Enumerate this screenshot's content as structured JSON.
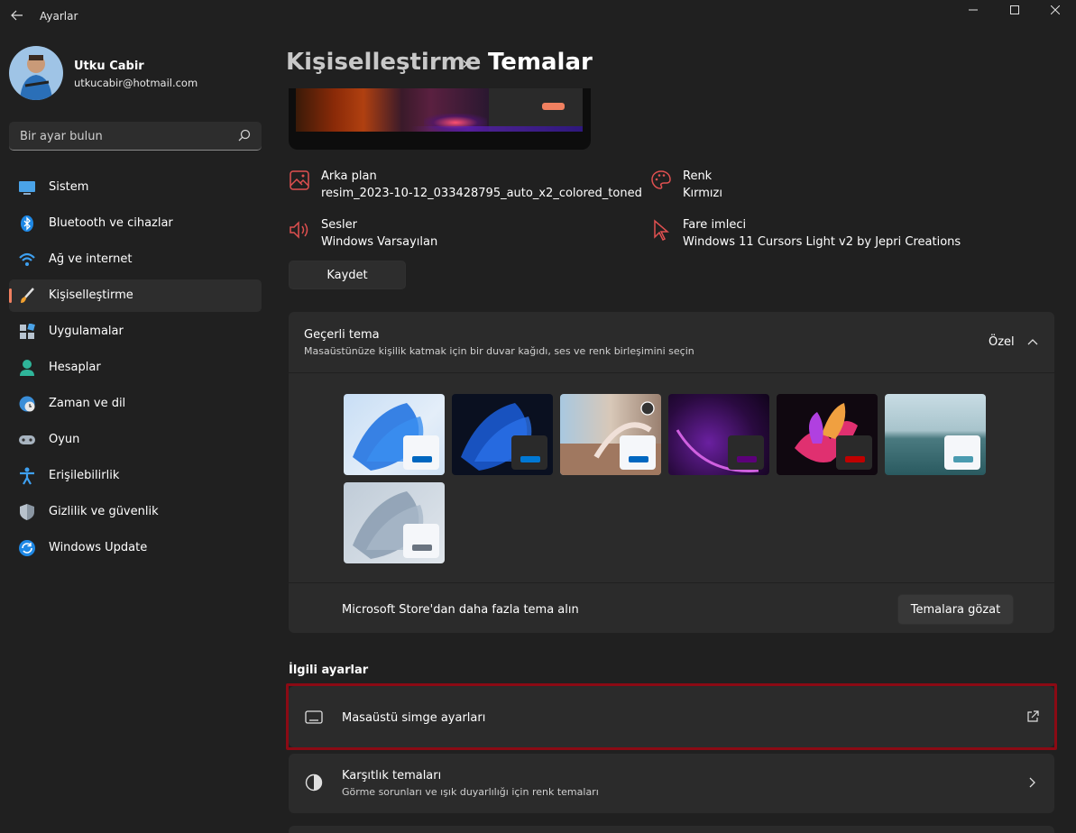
{
  "window": {
    "title": "Ayarlar"
  },
  "user": {
    "name": "Utku Cabir",
    "email": "utkucabir@hotmail.com"
  },
  "search": {
    "placeholder": "Bir ayar bulun"
  },
  "nav": {
    "items": [
      {
        "label": "Sistem",
        "icon": "monitor-icon"
      },
      {
        "label": "Bluetooth ve cihazlar",
        "icon": "bluetooth-icon"
      },
      {
        "label": "Ağ ve internet",
        "icon": "wifi-icon"
      },
      {
        "label": "Kişiselleştirme",
        "icon": "brush-icon",
        "active": true
      },
      {
        "label": "Uygulamalar",
        "icon": "apps-icon"
      },
      {
        "label": "Hesaplar",
        "icon": "person-icon"
      },
      {
        "label": "Zaman ve dil",
        "icon": "globe-clock-icon"
      },
      {
        "label": "Oyun",
        "icon": "gamepad-icon"
      },
      {
        "label": "Erişilebilirlik",
        "icon": "accessibility-icon"
      },
      {
        "label": "Gizlilik ve güvenlik",
        "icon": "shield-icon"
      },
      {
        "label": "Windows Update",
        "icon": "update-icon"
      }
    ]
  },
  "header": {
    "parent": "Kişiselleştirme",
    "separator": "›",
    "current": "Temalar"
  },
  "properties": {
    "background": {
      "title": "Arka plan",
      "value": "resim_2023-10-12_033428795_auto_x2_colored_toned"
    },
    "color": {
      "title": "Renk",
      "value": "Kırmızı"
    },
    "sounds": {
      "title": "Sesler",
      "value": "Windows Varsayılan"
    },
    "cursor": {
      "title": "Fare imleci",
      "value": "Windows 11 Cursors Light v2 by Jepri Creations"
    }
  },
  "save_button": "Kaydet",
  "current_theme": {
    "title": "Geçerli tema",
    "subtitle": "Masaüstünüze kişilik katmak için bir duvar kağıdı, ses ve renk birleşimini seçin",
    "value": "Özel",
    "themes": [
      {
        "name": "windows-light",
        "accent": "#0067c0"
      },
      {
        "name": "windows-dark",
        "accent": "#0078d4"
      },
      {
        "name": "glow",
        "accent": "#0067c0"
      },
      {
        "name": "captured-motion",
        "accent": "#5c007a"
      },
      {
        "name": "flow",
        "accent": "#c00000"
      },
      {
        "name": "sunrise",
        "accent": "#4a9bb0"
      },
      {
        "name": "windows-bloom-grey",
        "accent": "#6a7480"
      }
    ],
    "store_text": "Microsoft Store'dan daha fazla tema alın",
    "store_button": "Temalara gözat"
  },
  "related": {
    "heading": "İlgili ayarlar",
    "desktop_icons": {
      "title": "Masaüstü simge ayarları"
    },
    "contrast": {
      "title": "Karşıtlık temaları",
      "subtitle": "Görme sorunları ve ışık duyarlılığı için renk temaları"
    }
  },
  "colors": {
    "accent": "#f08060",
    "highlight_border": "#8b0a14",
    "background": "#202020",
    "card": "#2b2b2b"
  }
}
